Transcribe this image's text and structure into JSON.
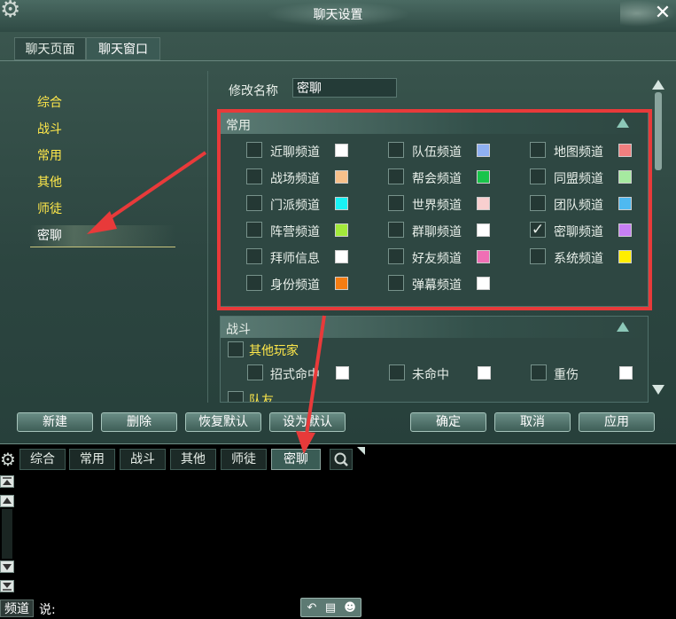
{
  "dialog": {
    "title": "聊天设置",
    "tabs": [
      {
        "label": "聊天页面",
        "active": false
      },
      {
        "label": "聊天窗口",
        "active": true
      }
    ],
    "categories": [
      "综合",
      "战斗",
      "常用",
      "其他",
      "师徒",
      "密聊"
    ],
    "selected_category": "密聊",
    "rename": {
      "label": "修改名称",
      "value": "密聊"
    },
    "groups": {
      "common": {
        "title": "常用",
        "channels": [
          {
            "label": "近聊频道",
            "checked": false,
            "color": "#ffffff"
          },
          {
            "label": "队伍频道",
            "checked": false,
            "color": "#8fb0f2"
          },
          {
            "label": "地图频道",
            "checked": false,
            "color": "#f07f7f"
          },
          {
            "label": "战场频道",
            "checked": false,
            "color": "#f7c08a"
          },
          {
            "label": "帮会频道",
            "checked": false,
            "color": "#19c44a"
          },
          {
            "label": "同盟频道",
            "checked": false,
            "color": "#a6eaa0"
          },
          {
            "label": "门派频道",
            "checked": false,
            "color": "#19f2f5"
          },
          {
            "label": "世界频道",
            "checked": false,
            "color": "#f8cfcf"
          },
          {
            "label": "团队频道",
            "checked": false,
            "color": "#4fb9f0"
          },
          {
            "label": "阵营频道",
            "checked": false,
            "color": "#a3ea3b"
          },
          {
            "label": "群聊频道",
            "checked": false,
            "color": "#ffffff"
          },
          {
            "label": "密聊频道",
            "checked": true,
            "color": "#c77ff3"
          },
          {
            "label": "拜师信息",
            "checked": false,
            "color": "#ffffff"
          },
          {
            "label": "好友频道",
            "checked": false,
            "color": "#f06fb5"
          },
          {
            "label": "系统频道",
            "checked": false,
            "color": "#ffee00"
          },
          {
            "label": "身份频道",
            "checked": false,
            "color": "#f57d13"
          },
          {
            "label": "弹幕频道",
            "checked": false,
            "color": "#ffffff"
          }
        ]
      },
      "battle": {
        "title": "战斗",
        "others_label": "其他玩家",
        "items": [
          {
            "label": "招式命中",
            "color": "#ffffff"
          },
          {
            "label": "未命中",
            "color": "#ffffff"
          },
          {
            "label": "重伤",
            "color": "#ffffff"
          }
        ],
        "team_label": "队友"
      }
    },
    "buttons": {
      "new": "新建",
      "delete": "删除",
      "restore": "恢复默认",
      "set_default": "设为默认",
      "ok": "确定",
      "cancel": "取消",
      "apply": "应用"
    }
  },
  "chat": {
    "tabs": [
      "综合",
      "常用",
      "战斗",
      "其他",
      "师徒",
      "密聊"
    ],
    "active_tab": "密聊",
    "channel": "频道",
    "say": "说:",
    "input_value": ""
  },
  "colors": {
    "highlight": "#e83a3a",
    "category_text": "#ffe84a"
  }
}
